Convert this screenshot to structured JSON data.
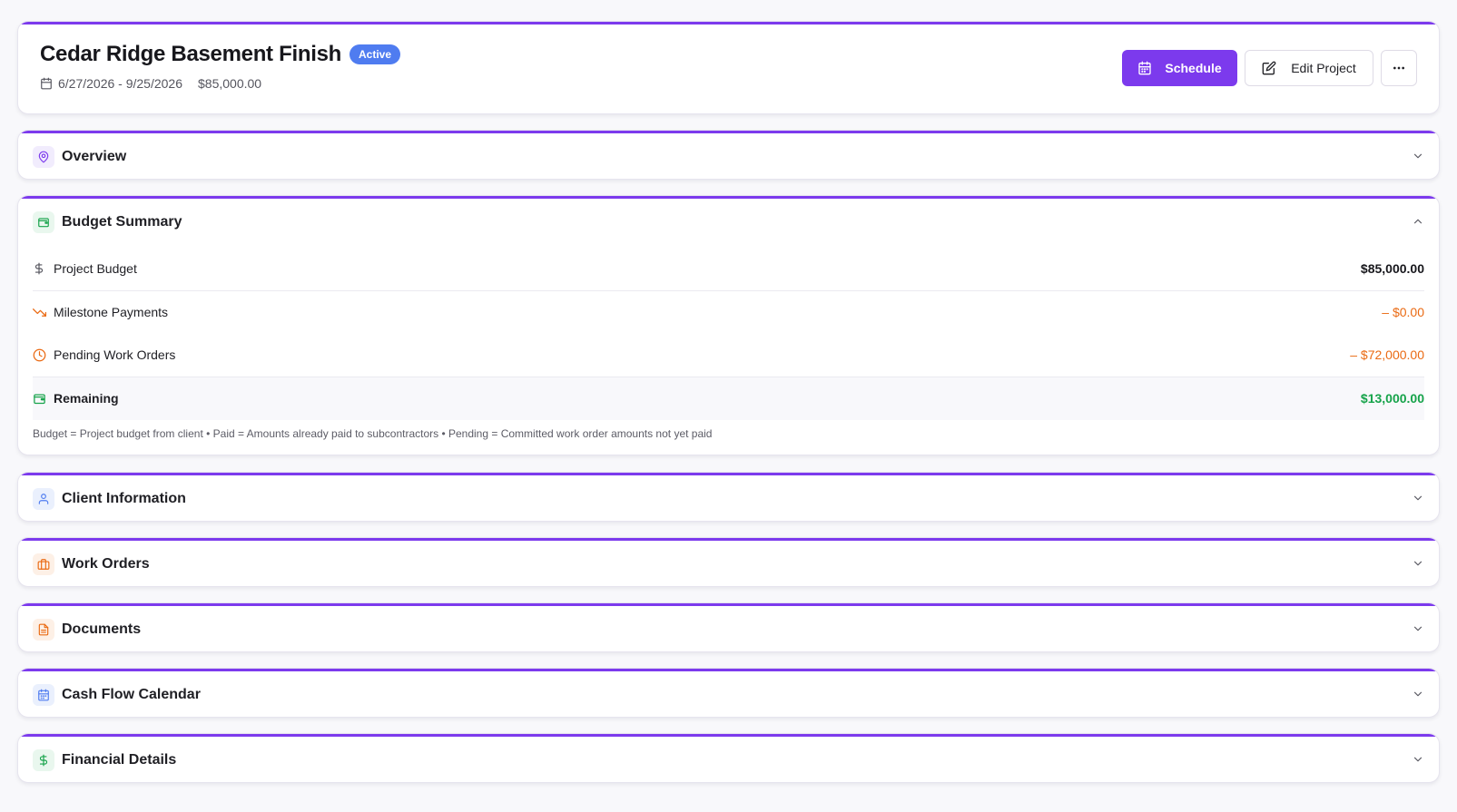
{
  "project": {
    "title": "Cedar Ridge Basement Finish",
    "status": "Active",
    "date_range": "6/27/2026 - 9/25/2026",
    "budget": "$85,000.00"
  },
  "actions": {
    "schedule_label": "Schedule",
    "edit_label": "Edit Project",
    "more_label": "···"
  },
  "sections": {
    "overview": "Overview",
    "budget_summary": "Budget Summary",
    "client_information": "Client Information",
    "work_orders": "Work Orders",
    "documents": "Documents",
    "cash_flow_calendar": "Cash Flow Calendar",
    "financial_details": "Financial Details"
  },
  "budget": {
    "rows": [
      {
        "label": "Project Budget",
        "value": "$85,000.00"
      },
      {
        "label": "Milestone Payments",
        "value": "– $0.00"
      },
      {
        "label": "Pending Work Orders",
        "value": "– $72,000.00"
      },
      {
        "label": "Remaining",
        "value": "$13,000.00"
      }
    ],
    "note": "Budget = Project budget from client • Paid = Amounts already paid to subcontractors • Pending = Committed work order amounts not yet paid"
  },
  "icons": {
    "calendar": "calendar-icon",
    "edit": "edit-icon",
    "more": "more-horizontal-icon",
    "map_pin": "map-pin-icon",
    "wallet": "wallet-icon",
    "dollar": "dollar-icon",
    "trending_down": "trending-down-icon",
    "clock": "clock-icon",
    "user": "user-icon",
    "briefcase": "briefcase-icon",
    "file": "file-text-icon",
    "chevron_down": "chevron-down-icon",
    "chevron_up": "chevron-up-icon"
  },
  "colors": {
    "accent": "#7c3aed",
    "status_badge": "#4f7cf0",
    "negative": "#ea6a13",
    "positive": "#16a34a",
    "overview_icon": "#7c3aed",
    "budget_icon": "#16a34a",
    "client_icon": "#4f7cf0",
    "work_orders_icon": "#ea6a13",
    "documents_icon": "#ea6a13",
    "cash_flow_icon": "#4f7cf0",
    "financial_icon": "#16a34a"
  }
}
